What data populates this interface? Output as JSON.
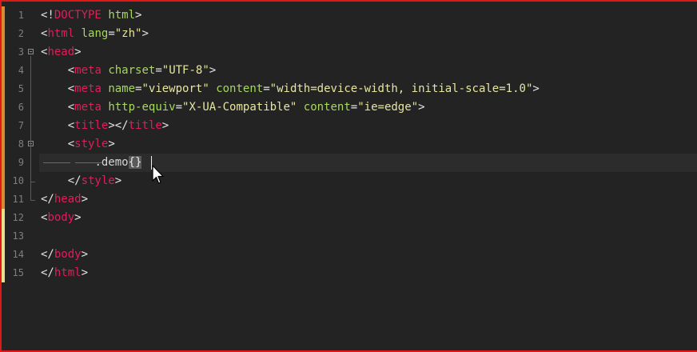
{
  "editor": {
    "lines": [
      {
        "num": "1",
        "parts": [
          [
            "punc",
            "<!"
          ],
          [
            "tag",
            "DOCTYPE"
          ],
          [
            "punc",
            " "
          ],
          [
            "attr",
            "html"
          ],
          [
            "punc",
            ">"
          ]
        ]
      },
      {
        "num": "2",
        "parts": [
          [
            "punc",
            "<"
          ],
          [
            "tag",
            "html"
          ],
          [
            "punc",
            " "
          ],
          [
            "attr",
            "lang"
          ],
          [
            "punc",
            "="
          ],
          [
            "val",
            "\"zh\""
          ],
          [
            "punc",
            ">"
          ]
        ]
      },
      {
        "num": "3",
        "parts": [
          [
            "punc",
            "<"
          ],
          [
            "tag",
            "head"
          ],
          [
            "punc",
            ">"
          ]
        ]
      },
      {
        "num": "4",
        "parts": [
          [
            "punc",
            "    <"
          ],
          [
            "tag",
            "meta"
          ],
          [
            "punc",
            " "
          ],
          [
            "attr",
            "charset"
          ],
          [
            "punc",
            "="
          ],
          [
            "val",
            "\"UTF-8\""
          ],
          [
            "punc",
            ">"
          ]
        ]
      },
      {
        "num": "5",
        "parts": [
          [
            "punc",
            "    <"
          ],
          [
            "tag",
            "meta"
          ],
          [
            "punc",
            " "
          ],
          [
            "attr",
            "name"
          ],
          [
            "punc",
            "="
          ],
          [
            "val",
            "\"viewport\""
          ],
          [
            "punc",
            " "
          ],
          [
            "attr",
            "content"
          ],
          [
            "punc",
            "="
          ],
          [
            "val",
            "\"width=device-width, initial-scale=1.0\""
          ],
          [
            "punc",
            ">"
          ]
        ]
      },
      {
        "num": "6",
        "parts": [
          [
            "punc",
            "    <"
          ],
          [
            "tag",
            "meta"
          ],
          [
            "punc",
            " "
          ],
          [
            "attr",
            "http-equiv"
          ],
          [
            "punc",
            "="
          ],
          [
            "val",
            "\"X-UA-Compatible\""
          ],
          [
            "punc",
            " "
          ],
          [
            "attr",
            "content"
          ],
          [
            "punc",
            "="
          ],
          [
            "val",
            "\"ie=edge\""
          ],
          [
            "punc",
            ">"
          ]
        ]
      },
      {
        "num": "7",
        "parts": [
          [
            "punc",
            "    <"
          ],
          [
            "tag",
            "title"
          ],
          [
            "punc",
            "></"
          ],
          [
            "tag",
            "title"
          ],
          [
            "punc",
            ">"
          ]
        ]
      },
      {
        "num": "8",
        "parts": [
          [
            "punc",
            "    <"
          ],
          [
            "tag",
            "style"
          ],
          [
            "punc",
            ">"
          ]
        ]
      },
      {
        "num": "9",
        "parts": [
          [
            "punc",
            "        "
          ],
          [
            "sel",
            ".demo"
          ],
          [
            "brace-hl",
            "{"
          ],
          [
            "brace-hl",
            "}"
          ]
        ]
      },
      {
        "num": "10",
        "parts": [
          [
            "punc",
            "    </"
          ],
          [
            "tag",
            "style"
          ],
          [
            "punc",
            ">"
          ]
        ]
      },
      {
        "num": "11",
        "parts": [
          [
            "punc",
            "</"
          ],
          [
            "tag",
            "head"
          ],
          [
            "punc",
            ">"
          ]
        ]
      },
      {
        "num": "12",
        "parts": [
          [
            "punc",
            "<"
          ],
          [
            "tag",
            "body"
          ],
          [
            "punc",
            ">"
          ]
        ]
      },
      {
        "num": "13",
        "parts": []
      },
      {
        "num": "14",
        "parts": [
          [
            "punc",
            "</"
          ],
          [
            "tag",
            "body"
          ],
          [
            "punc",
            ">"
          ]
        ]
      },
      {
        "num": "15",
        "parts": [
          [
            "punc",
            "</"
          ],
          [
            "tag",
            "html"
          ],
          [
            "punc",
            ">"
          ]
        ]
      }
    ],
    "modified_lines": {
      "orange": [
        "1",
        "2",
        "3",
        "4",
        "5",
        "6",
        "7",
        "8",
        "9",
        "10",
        "11"
      ],
      "yellow": [
        "12",
        "13",
        "14",
        "15"
      ]
    },
    "current_line": "9",
    "fold_markers": [
      "3",
      "8"
    ],
    "cursor_icon": "mouse-pointer-icon",
    "colors": {
      "tag": "#e01e5a",
      "attribute": "#a6d85c",
      "string": "#e6e6a0",
      "background": "#232323",
      "window_border": "#e01818"
    }
  }
}
